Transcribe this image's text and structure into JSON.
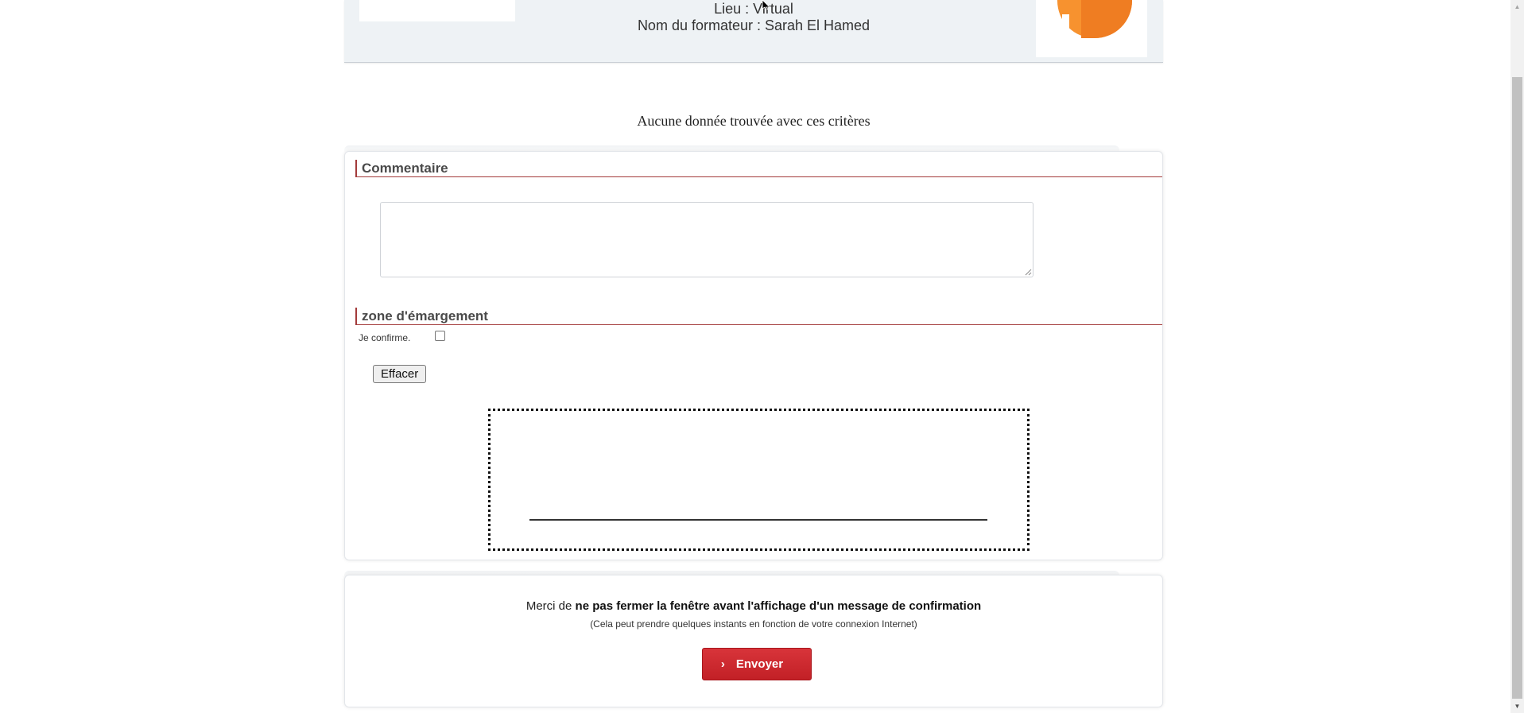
{
  "header": {
    "location_line": "Lieu : Virtual",
    "trainer_line": "Nom du formateur : Sarah El Hamed",
    "logo_colors": {
      "primary": "#f7922f",
      "shade": "#ef7d22"
    }
  },
  "results": {
    "empty_message": "Aucune donnée trouvée avec ces critères"
  },
  "comment_section": {
    "heading": "Commentaire",
    "textarea_value": "",
    "textarea_placeholder": ""
  },
  "signature_section": {
    "heading": "zone d'émargement",
    "confirm_label": "Je confirme.",
    "confirm_checked": false,
    "clear_button_label": "Effacer"
  },
  "submit_section": {
    "notice_prefix": "Merci de ",
    "notice_bold": "ne pas fermer la fenêtre avant l'affichage d'un message de confirmation",
    "notice_sub": "(Cela peut prendre quelques instants en fonction de votre connexion Internet)",
    "send_button_label": "Envoyer",
    "send_button_icon": "chevron-right-icon",
    "accent_color": "#c22026"
  },
  "theme": {
    "section_border_color": "#a33a3a"
  }
}
